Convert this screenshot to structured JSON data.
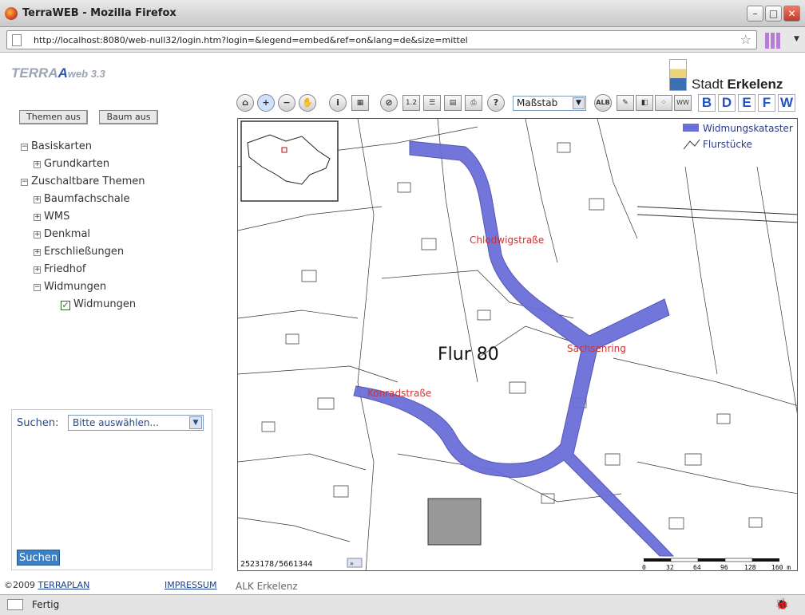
{
  "window": {
    "title": "TerraWEB - Mozilla Firefox"
  },
  "browser": {
    "url": "http://localhost:8080/web-null32/login.htm?login=&legend=embed&ref=on&lang=de&size=mittel",
    "status": "Fertig"
  },
  "header": {
    "logo_terra": "TERRA",
    "logo_web": "web 3.3",
    "city_prefix": "Stadt",
    "city_name": "Erkelenz"
  },
  "buttons": {
    "themen_aus": "Themen aus",
    "baum_aus": "Baum aus",
    "suchen": "Suchen"
  },
  "tree": [
    {
      "label": "Basiskarten",
      "sign": "−",
      "level": 0
    },
    {
      "label": "Grundkarten",
      "sign": "+",
      "level": 1
    },
    {
      "label": "Zuschaltbare Themen",
      "sign": "−",
      "level": 0
    },
    {
      "label": "Baumfachschale",
      "sign": "+",
      "level": 1
    },
    {
      "label": "WMS",
      "sign": "+",
      "level": 1
    },
    {
      "label": "Denkmal",
      "sign": "+",
      "level": 1
    },
    {
      "label": "Erschließungen",
      "sign": "+",
      "level": 1
    },
    {
      "label": "Friedhof",
      "sign": "+",
      "level": 1
    },
    {
      "label": "Widmungen",
      "sign": "−",
      "level": 1
    },
    {
      "label": "Widmungen",
      "checked": true,
      "level": 2
    }
  ],
  "search": {
    "label": "Suchen:",
    "placeholder": "Bitte auswählen..."
  },
  "footer": {
    "copyright": "©2009",
    "terraplan": "TERRAPLAN",
    "impressum": "IMPRESSUM",
    "alk": "ALK Erkelenz"
  },
  "toolbar": {
    "scale_label": "Maßstab",
    "alb": "ALB",
    "help": "?",
    "letters": [
      "B",
      "D",
      "E",
      "F",
      "W"
    ],
    "ww": "WW"
  },
  "map": {
    "legend": [
      {
        "label": "Widmungskataster",
        "color": "#6b6fd9"
      },
      {
        "label": "Flurstücke"
      }
    ],
    "flur": "Flur 80",
    "streets": [
      "Chlodwigstraße",
      "Sachsenring",
      "Konradstraße"
    ],
    "coords": "2523178/5661344",
    "scalebar": {
      "ticks": [
        "0",
        "32",
        "64",
        "96",
        "128",
        "160 m"
      ]
    }
  }
}
